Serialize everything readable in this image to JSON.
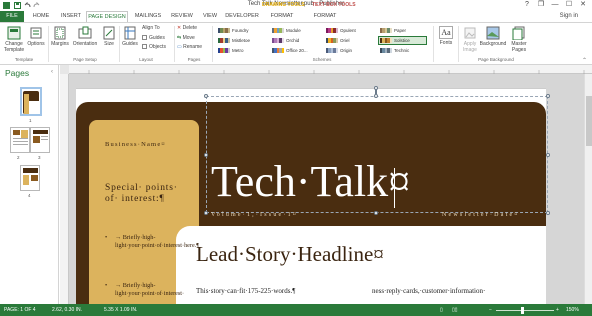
{
  "titlebar": {
    "title": "Tech Talk Newsletter.pub - Publisher",
    "context_tools": [
      {
        "label": "DRAWING TOOLS",
        "color": "#e0a800"
      },
      {
        "label": "TEXT BOX TOOLS",
        "color": "#c0504d"
      }
    ],
    "window_buttons": [
      "?",
      "❐",
      "—",
      "☐",
      "✕"
    ]
  },
  "tabs": [
    "FILE",
    "HOME",
    "INSERT",
    "PAGE DESIGN",
    "MAILINGS",
    "REVIEW",
    "VIEW",
    "DEVELOPER",
    "FORMAT",
    "FORMAT"
  ],
  "active_tab": "PAGE DESIGN",
  "signin": "Sign in",
  "ribbon": {
    "template_group": {
      "change_template": "Change Template",
      "options": "Options",
      "label": "Template"
    },
    "page_setup_group": {
      "margins": "Margins",
      "orientation": "Orientation",
      "size": "Size",
      "label": "Page Setup"
    },
    "layout_group": {
      "guides": "Guides",
      "align_to": "Align To",
      "guides_chk": "Guides",
      "objects_chk": "Objects",
      "label": "Layout"
    },
    "pages_group": {
      "delete": "Delete",
      "move": "Move",
      "rename": "Rename",
      "label": "Pages"
    },
    "schemes_group": {
      "label": "Schemes",
      "schemes": [
        {
          "name": "Foundry",
          "colors": [
            "#3b4e6b",
            "#6f8a52",
            "#b5a26a",
            "#8a6d4a",
            "#c8b98d"
          ]
        },
        {
          "name": "Mistletoe",
          "colors": [
            "#2c6b3f",
            "#a33a2e",
            "#e7d08c",
            "#3a5f88",
            "#c9c1a0"
          ]
        },
        {
          "name": "Metro",
          "colors": [
            "#25408f",
            "#e6502f",
            "#8fc050",
            "#6b3aa0",
            "#c9c9c9"
          ]
        },
        {
          "name": "Module",
          "colors": [
            "#5e6e7e",
            "#f0a030",
            "#6aa0c8",
            "#98b858",
            "#d8d8d8"
          ]
        },
        {
          "name": "Orchid",
          "colors": [
            "#7a4a90",
            "#b07ab8",
            "#d8b0d8",
            "#5a3a6a",
            "#e8dce8"
          ]
        },
        {
          "name": "Office 20...",
          "colors": [
            "#44546a",
            "#4472c4",
            "#ed7d31",
            "#a5a5a5",
            "#ffc000"
          ]
        },
        {
          "name": "Opulent",
          "colors": [
            "#7a1a5a",
            "#b83a8a",
            "#e8a030",
            "#8a2a2a",
            "#d8b0c8"
          ]
        },
        {
          "name": "Oriel",
          "colors": [
            "#3a4a5a",
            "#f0b020",
            "#d86020",
            "#8a9a5a",
            "#d8c8a8"
          ]
        },
        {
          "name": "Origin",
          "colors": [
            "#4a5a7a",
            "#8aa0c0",
            "#b0c0d8",
            "#6a7a9a",
            "#d8dce8"
          ]
        },
        {
          "name": "Paper",
          "colors": [
            "#8a6a4a",
            "#b8a070",
            "#d8c898",
            "#6a8a6a",
            "#e8e0c8"
          ]
        },
        {
          "name": "Solstice",
          "colors": [
            "#4a2d10",
            "#dcb35d",
            "#8a5a20",
            "#c08030",
            "#f0e0c0"
          ],
          "selected": true
        },
        {
          "name": "Technic",
          "colors": [
            "#3a4a5a",
            "#6a8aa0",
            "#a0b0c0",
            "#5a6a7a",
            "#d0d8e0"
          ]
        }
      ]
    },
    "fonts": "Fonts",
    "apply_image": "Apply Image",
    "background": "Background",
    "master_pages": "Master Pages",
    "page_background_label": "Page Background"
  },
  "pages_pane": {
    "title": "Pages",
    "collapse": "‹",
    "page_labels": [
      "1",
      "2",
      "3",
      "4"
    ]
  },
  "document": {
    "business_name": "Business·Name¤",
    "special_points": "Special· points· of· interest:¶",
    "bullets": [
      "→ Briefly·high-light·your·point·of·interest·here.¶",
      "→ Briefly·high-light·your·point·of·interest·"
    ],
    "bullet_mark": "•",
    "title": "Tech·Talk¤",
    "volume": "Volume·1,·Issue·1¤",
    "newsletter_date": "Newsletter·Date¤",
    "lead_headline": "Lead·Story·Headline¤",
    "body_left": "This·story·can·fit·175-225·words.¶",
    "body_right": "ness·reply·cards,·customer·information·"
  },
  "statusbar": {
    "page": "PAGE: 1 OF 4",
    "position": "2.62, 0.30 IN.",
    "size": "5.35 X 1.09 IN.",
    "zoom": "150%"
  }
}
